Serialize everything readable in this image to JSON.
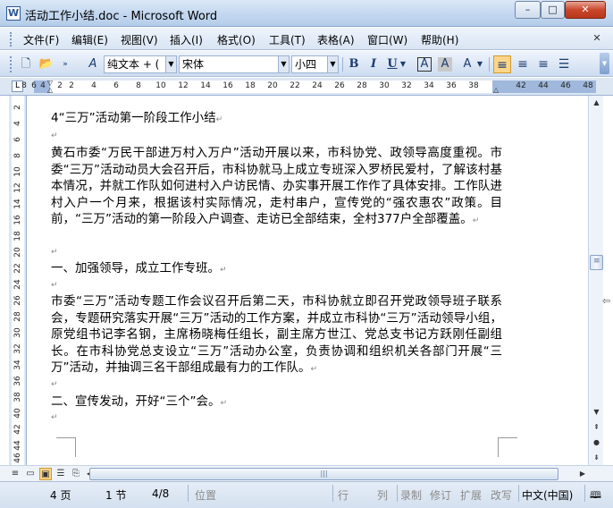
{
  "window": {
    "title": "活动工作小结.doc - Microsoft Word",
    "minimize": "–",
    "maximize": "□",
    "close": "✕"
  },
  "menu": {
    "items": [
      "文件(F)",
      "编辑(E)",
      "视图(V)",
      "插入(I)",
      "格式(O)",
      "工具(T)",
      "表格(A)",
      "窗口(W)",
      "帮助(H)"
    ],
    "close_doc": "✕"
  },
  "toolbar": {
    "style_value": "纯文本 + (",
    "font_value": "宋体",
    "size_value": "小四",
    "bold": "B",
    "italic": "I",
    "underline": "U",
    "char_border": "A",
    "char_shading": "A",
    "highlight": "A"
  },
  "ruler": {
    "ticks": [
      "8",
      "6",
      "4",
      "2",
      "2",
      "4",
      "6",
      "8",
      "10",
      "12",
      "14",
      "16",
      "18",
      "20",
      "22",
      "24",
      "26",
      "28",
      "30",
      "32",
      "34",
      "36",
      "38",
      "42",
      "44",
      "46",
      "48"
    ],
    "tab_selector": "L"
  },
  "vruler": {
    "ticks": [
      "2",
      "4",
      "6",
      "8",
      "10",
      "12",
      "14",
      "16",
      "18",
      "20",
      "22",
      "24",
      "26",
      "28",
      "30",
      "32",
      "34",
      "36",
      "38",
      "40",
      "42",
      "44",
      "46"
    ]
  },
  "document": {
    "paragraphs": [
      {
        "text": "4“三万”活动第一阶段工作小结"
      },
      {
        "text": ""
      },
      {
        "text": "黄石市委“万民干部进万村入万户”活动开展以来，市科协党、政领导高度重视。市委“三万”活动动员大会召开后，市科协就马上成立专班深入罗桥民爱村，了解该村基本情况，并就工作队如何进村入户访民情、办实事开展工作作了具体安排。工作队进村入户一个月来，根据该村实际情况，走村串户，宣传党的“强农惠农”政策。目前，“三万”活动的第一阶段入户调查、走访已全部结束，全村377户全部覆盖。"
      },
      {
        "text": ""
      },
      {
        "text": "一、加强领导，成立工作专班。"
      },
      {
        "text": ""
      },
      {
        "text": "市委“三万”活动专题工作会议召开后第二天，市科协就立即召开党政领导班子联系会，专题研究落实开展“三万”活动的工作方案，并成立市科协“三万”活动领导小组，原党组书记李名钢，主席杨晓梅任组长，副主席方世江、党总支书记方跃刚任副组长。在市科协党总支设立“三万”活动办公室，负责协调和组织机关各部门开展“三万”活动，并抽调三名干部组成最有力的工作队。"
      },
      {
        "text": ""
      },
      {
        "text": "二、宣传发动，开好“三个”会。"
      },
      {
        "text": ""
      }
    ],
    "paragraph_mark": "↵"
  },
  "status": {
    "page": "4 页",
    "section": "1 节",
    "page_of": "4/8",
    "position": "位置",
    "line": "行",
    "column": "列",
    "rec": "录制",
    "trk": "修订",
    "ext": "扩展",
    "ovr": "改写",
    "language": "中文(中国)"
  },
  "colors": {
    "titlebar": "#c4d8f0",
    "toolbar": "#d9e5f4",
    "active_button": "#fbd68a",
    "close_button": "#c9472b"
  }
}
